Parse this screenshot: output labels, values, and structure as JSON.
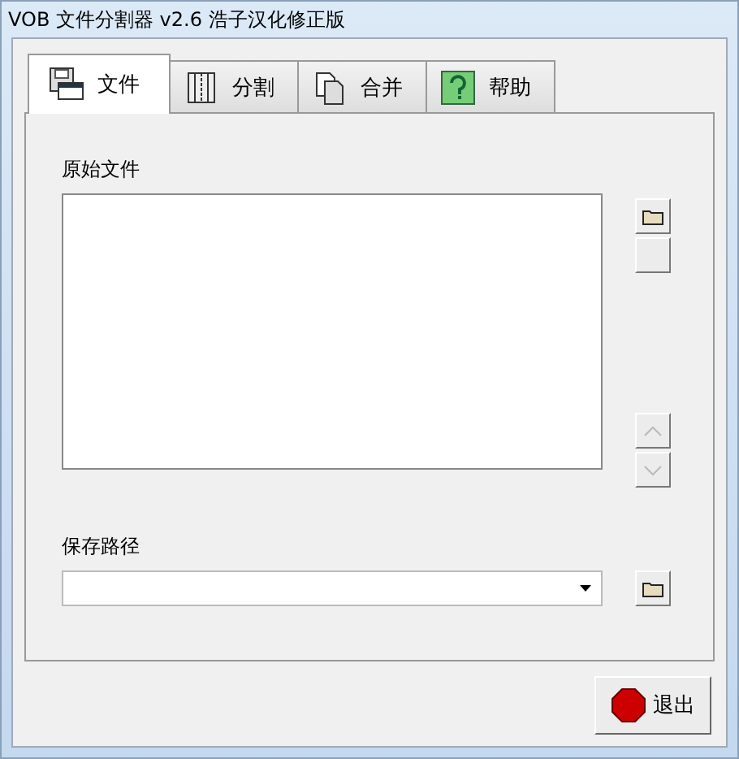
{
  "window": {
    "title": "VOB 文件分割器 v2.6 浩子汉化修正版"
  },
  "tabs": [
    {
      "label": "文件",
      "kind": "disk",
      "selected": true
    },
    {
      "label": "分割",
      "kind": "split",
      "selected": false
    },
    {
      "label": "合并",
      "kind": "pages",
      "selected": false
    },
    {
      "label": "帮助",
      "kind": "help",
      "selected": false
    }
  ],
  "source": {
    "label": "原始文件"
  },
  "side_buttons": [
    {
      "kind": "folder"
    },
    {
      "kind": "blank"
    },
    {
      "kind": "up",
      "disabled": true
    },
    {
      "kind": "down",
      "disabled": true
    }
  ],
  "save": {
    "label": "保存路径"
  },
  "exit_button": {
    "label": "退出"
  }
}
